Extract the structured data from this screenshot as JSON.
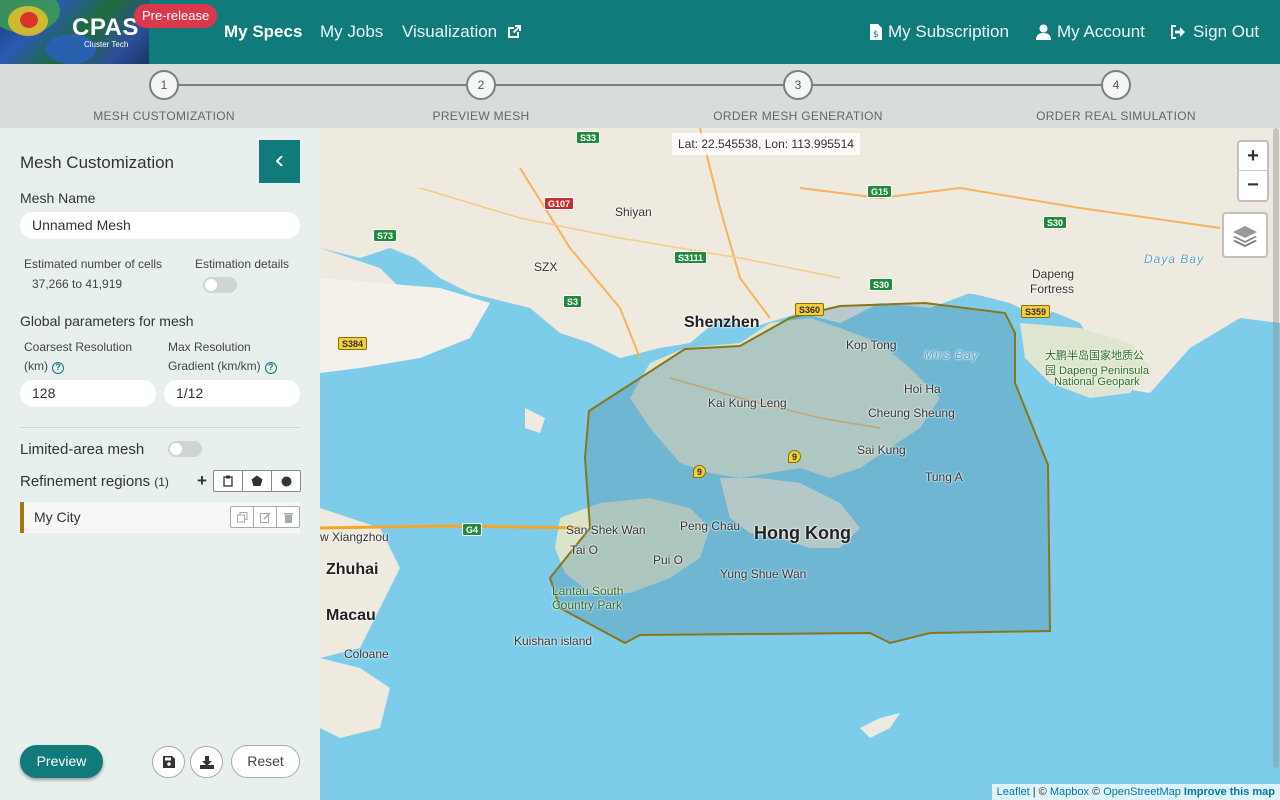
{
  "header": {
    "logo_text": "CPAS",
    "logo_sub": "Cluster Tech",
    "badge": "Pre-release",
    "nav_left": [
      "My Specs",
      "My Jobs",
      "Visualization"
    ],
    "nav_right": [
      "My Subscription",
      "My Account",
      "Sign Out"
    ],
    "brand_color": "#117a7a"
  },
  "steps": [
    {
      "num": "1",
      "label": "MESH CUSTOMIZATION"
    },
    {
      "num": "2",
      "label": "PREVIEW MESH"
    },
    {
      "num": "3",
      "label": "ORDER MESH GENERATION"
    },
    {
      "num": "4",
      "label": "ORDER REAL SIMULATION"
    }
  ],
  "sidebar": {
    "title": "Mesh Customization",
    "mesh_name_label": "Mesh Name",
    "mesh_name_value": "Unnamed Mesh",
    "est_cells_label": "Estimated number of cells",
    "est_cells_value": "37,266 to 41,919",
    "est_details_label": "Estimation details",
    "global_params_label": "Global parameters for mesh",
    "coarsest_label_1": "Coarsest Resolution",
    "coarsest_label_2": "(km)",
    "coarsest_value": "128",
    "maxres_label_1": "Max Resolution",
    "maxres_label_2": "Gradient (km/km)",
    "maxres_value": "1/12",
    "limited_area_label": "Limited-area mesh",
    "refinement_label": "Refinement regions",
    "refinement_count": "(1)",
    "regions": [
      {
        "name": "My City",
        "color": "#a3780a"
      }
    ],
    "preview_label": "Preview",
    "reset_label": "Reset"
  },
  "map": {
    "coords": "Lat: 22.545538, Lon: 113.995514",
    "zoom_in": "+",
    "zoom_out": "−",
    "attribution": {
      "leaflet": "Leaflet",
      "sep1": " | © ",
      "mapbox": "Mapbox",
      "sep2": " © ",
      "osm": "OpenStreetMap",
      "improve": "Improve this map"
    },
    "places": {
      "shenzhen": "Shenzhen",
      "hongkong": "Hong Kong",
      "zhuhai": "Zhuhai",
      "macau": "Macau",
      "shiyan": "Shiyan",
      "szx": "SZX",
      "kaikungleng": "Kai Kung Leng",
      "koptong": "Kop Tong",
      "hoiha": "Hoi Ha",
      "cheungsheung": "Cheung Sheung",
      "saikung": "Sai Kung",
      "tunga": "Tung A",
      "sanshekwan": "San Shek Wan",
      "taio": "Tai O",
      "pengchau": "Peng Chau",
      "puio": "Pui O",
      "yungshuewan": "Yung Shue Wan",
      "lantau1": "Lantau South",
      "lantau2": "Country Park",
      "kuishan": "Kuishan island",
      "coloane": "Coloane",
      "xiangzhou": "w Xiangzhou",
      "dapeng1": "Dapeng",
      "dapeng2": "Fortress",
      "dp_cn1": "大鹏半岛国家地质公",
      "dp_cn2": "园 Dapeng Peninsula",
      "dp_cn3": "National Geopark",
      "daya": "Daya Bay",
      "mirs": "Mirs Bay"
    },
    "shields": {
      "s33": "S33",
      "g107": "G107",
      "s73": "S73",
      "s3111": "S3111",
      "g15": "G15",
      "s30a": "S30",
      "s30b": "S30",
      "s3": "S3",
      "s360": "S360",
      "s359": "S359",
      "s384": "S384",
      "g4": "G4",
      "n9a": "9",
      "n9b": "9"
    }
  }
}
